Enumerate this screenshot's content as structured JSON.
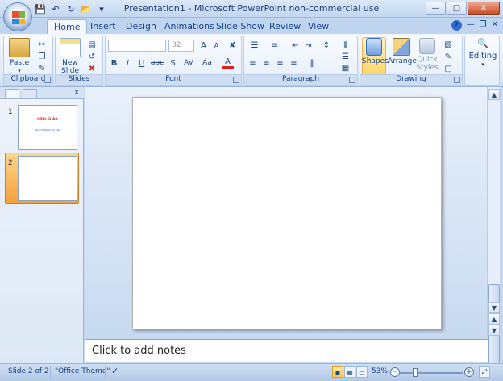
{
  "window": {
    "title": "Presentation1 - Microsoft PowerPoint non-commercial use"
  },
  "qat": {
    "icons": [
      "save-icon",
      "undo-icon",
      "redo-icon",
      "open-icon",
      "customize-icon"
    ]
  },
  "tabs": [
    {
      "label": "Home",
      "active": true
    },
    {
      "label": "Insert"
    },
    {
      "label": "Design"
    },
    {
      "label": "Animations"
    },
    {
      "label": "Slide Show"
    },
    {
      "label": "Review"
    },
    {
      "label": "View"
    }
  ],
  "ribbon": {
    "clipboard": {
      "label": "Clipboard",
      "paste": "Paste"
    },
    "slides": {
      "label": "Slides",
      "new_slide_line1": "New",
      "new_slide_line2": "Slide"
    },
    "font": {
      "label": "Font",
      "font_name": "",
      "font_size": "32",
      "bold": "B",
      "italic": "I",
      "underline": "U",
      "strike": "abc",
      "shadow": "S",
      "spacing": "AV",
      "case": "Aa",
      "color": "A",
      "grow": "A",
      "shrink": "A"
    },
    "paragraph": {
      "label": "Paragraph"
    },
    "drawing": {
      "label": "Drawing",
      "shapes": "Shapes",
      "arrange": "Arrange",
      "quick_styles_line1": "Quick",
      "quick_styles_line2": "Styles"
    },
    "editing": {
      "label": "Editing"
    }
  },
  "slides_panel": {
    "close": "x",
    "thumbs": [
      {
        "num": "1",
        "line1": "KÍNH CHÀO",
        "line2": "Quý Vị Thăm Dự Lớp"
      },
      {
        "num": "2"
      }
    ]
  },
  "notes": {
    "placeholder": "Click to add notes"
  },
  "status": {
    "slide": "Slide 2 of 2",
    "theme": "\"Office Theme\"",
    "zoom": "53%",
    "zoom_minus": "−",
    "zoom_plus": "+"
  },
  "colors": {
    "accent": "#15428b",
    "ribbon_bg": "#e2ecf8",
    "selected": "#f3a13a"
  }
}
